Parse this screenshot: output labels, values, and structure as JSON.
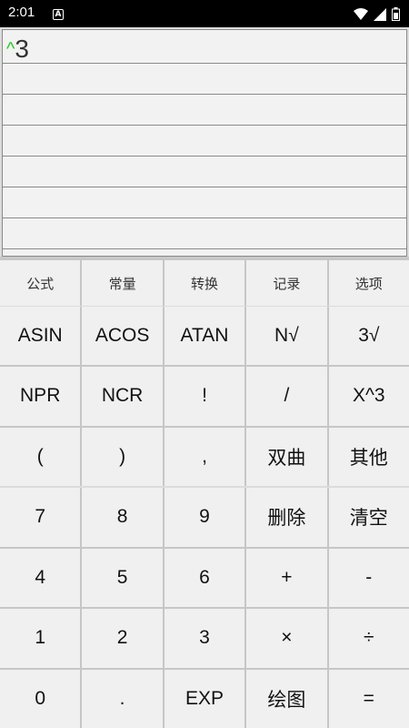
{
  "status_bar": {
    "time": "2:01",
    "app_icon_letter": "A",
    "icons": [
      "wifi-icon",
      "signal-icon",
      "battery-icon"
    ]
  },
  "display": {
    "caret": "^",
    "expression": "3",
    "caret_color": "#22cc22"
  },
  "tabs": [
    "公式",
    "常量",
    "转换",
    "记录",
    "选项"
  ],
  "function_keys": [
    [
      "ASIN",
      "ACOS",
      "ATAN",
      "N√",
      "3√"
    ],
    [
      "NPR",
      "NCR",
      "!",
      "/",
      "X^3"
    ],
    [
      "(",
      ")",
      ",",
      "双曲",
      "其他"
    ]
  ],
  "number_keys": [
    [
      "7",
      "8",
      "9",
      "删除",
      "清空"
    ],
    [
      "4",
      "5",
      "6",
      "+",
      "-"
    ],
    [
      "1",
      "2",
      "3",
      "×",
      "÷"
    ],
    [
      "0",
      ".",
      "EXP",
      "绘图",
      "="
    ]
  ]
}
